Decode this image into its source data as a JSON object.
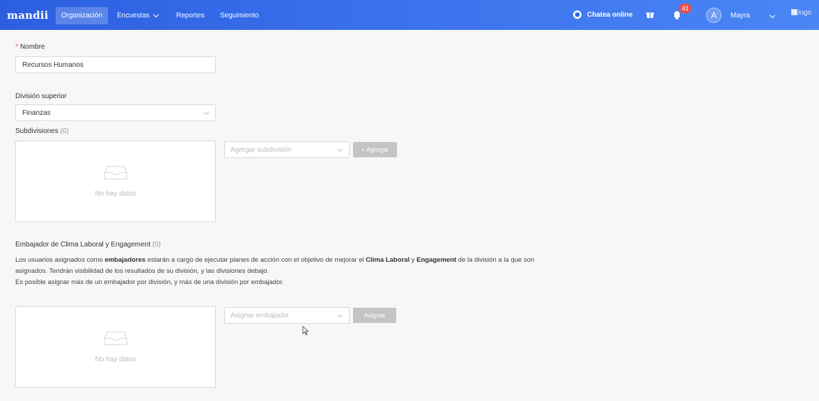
{
  "nav": {
    "logo": "mandii",
    "items": [
      {
        "label": "Organización",
        "active": true
      },
      {
        "label": "Encuestas",
        "has_dropdown": true
      },
      {
        "label": "Reportes"
      },
      {
        "label": "Seguimiento"
      }
    ],
    "chat_label": "Chatea online",
    "notification_count": "41",
    "avatar_initial": "A",
    "user_name": "Mayra",
    "logo_alt": "logo"
  },
  "form": {
    "nombre": {
      "label": "Nombre",
      "required_mark": "*",
      "value": "Recursos Humanos"
    },
    "division_superior": {
      "label": "División superior",
      "value": "Finanzas"
    },
    "subdivisiones": {
      "label": "Subdivisiones",
      "count": "(0)",
      "empty_text": "No hay datos",
      "select_placeholder": "Agregar subdivisión",
      "add_button": "+ Agregar"
    },
    "embajador": {
      "label": "Embajador de Clima Laboral y Engagement",
      "count": "(0)",
      "desc_part1": "Los usuarios asignados como ",
      "desc_bold1": "embajadores",
      "desc_part2": " estarán a cargo de ejecutar planes de acción con el objetivo de mejorar el ",
      "desc_bold2": "Clima Laboral",
      "desc_part3": " y ",
      "desc_bold3": "Engagement",
      "desc_part4": " de la división a la que son asignados. Tendrán visibilidad de los resultados de su división, y las divisiones debajo.",
      "desc_line2": "Es posible asignar más de un embajador por división, y más de una división por embajador.",
      "empty_text": "No hay datos",
      "select_placeholder": "Asignar embajador",
      "assign_button": "Asignar"
    }
  }
}
